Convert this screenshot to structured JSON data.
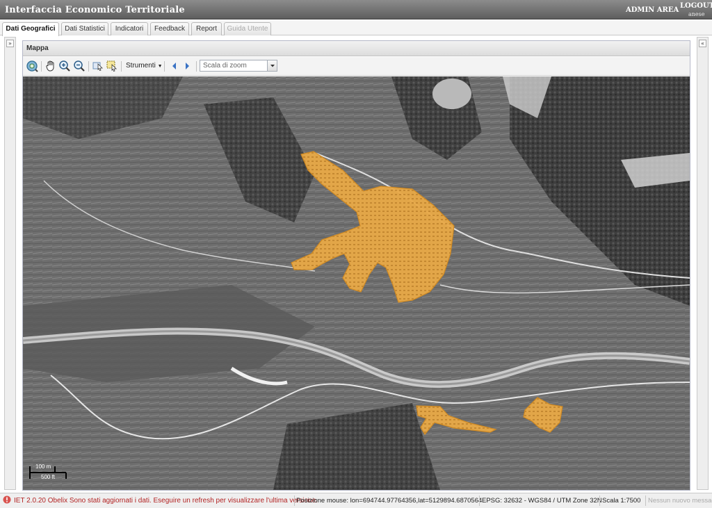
{
  "header": {
    "title": "Interfaccia Economico Territoriale",
    "admin_area": "ADMIN AREA",
    "logout": "LOGOUT",
    "username": "anese"
  },
  "tabs": [
    {
      "label": "Dati Geografici",
      "active": true
    },
    {
      "label": "Dati Statistici"
    },
    {
      "label": "Indicatori"
    },
    {
      "label": "Feedback"
    },
    {
      "label": "Report"
    },
    {
      "label": "Guida Utente",
      "disabled": true
    }
  ],
  "sidebars": {
    "left_toggle": "»",
    "right_toggle": "«"
  },
  "panel": {
    "title": "Mappa"
  },
  "toolbar": {
    "strumenti_label": "Strumenti",
    "zoom_placeholder": "Scala di zoom",
    "icons": [
      "zoom-extent-icon",
      "pan-hand-icon",
      "zoom-in-icon",
      "zoom-out-icon",
      "info-icon",
      "select-icon",
      "nav-back-icon",
      "nav-forward-icon"
    ]
  },
  "map": {
    "scale_metric": "100 m",
    "scale_imperial": "500 ft",
    "highlight_color": "#f0a63c"
  },
  "statusbar": {
    "message": "IET 2.0.20 Obelix Sono stati aggiornati i dati. Eseguire un refresh per visualizzare l'ultima versione.",
    "mouse_position": "Posizione mouse: lon=694744.97764356,lat=5129894.6870564",
    "projection": "EPSG: 32632 - WGS84 / UTM Zone 32N",
    "scale": "Scala 1:7500",
    "notifications": "Nessun nuovo messaggio"
  },
  "colors": {
    "header_bg": "#6f6f6f",
    "error_text": "#b22222",
    "highlight": "#f0a63c"
  }
}
